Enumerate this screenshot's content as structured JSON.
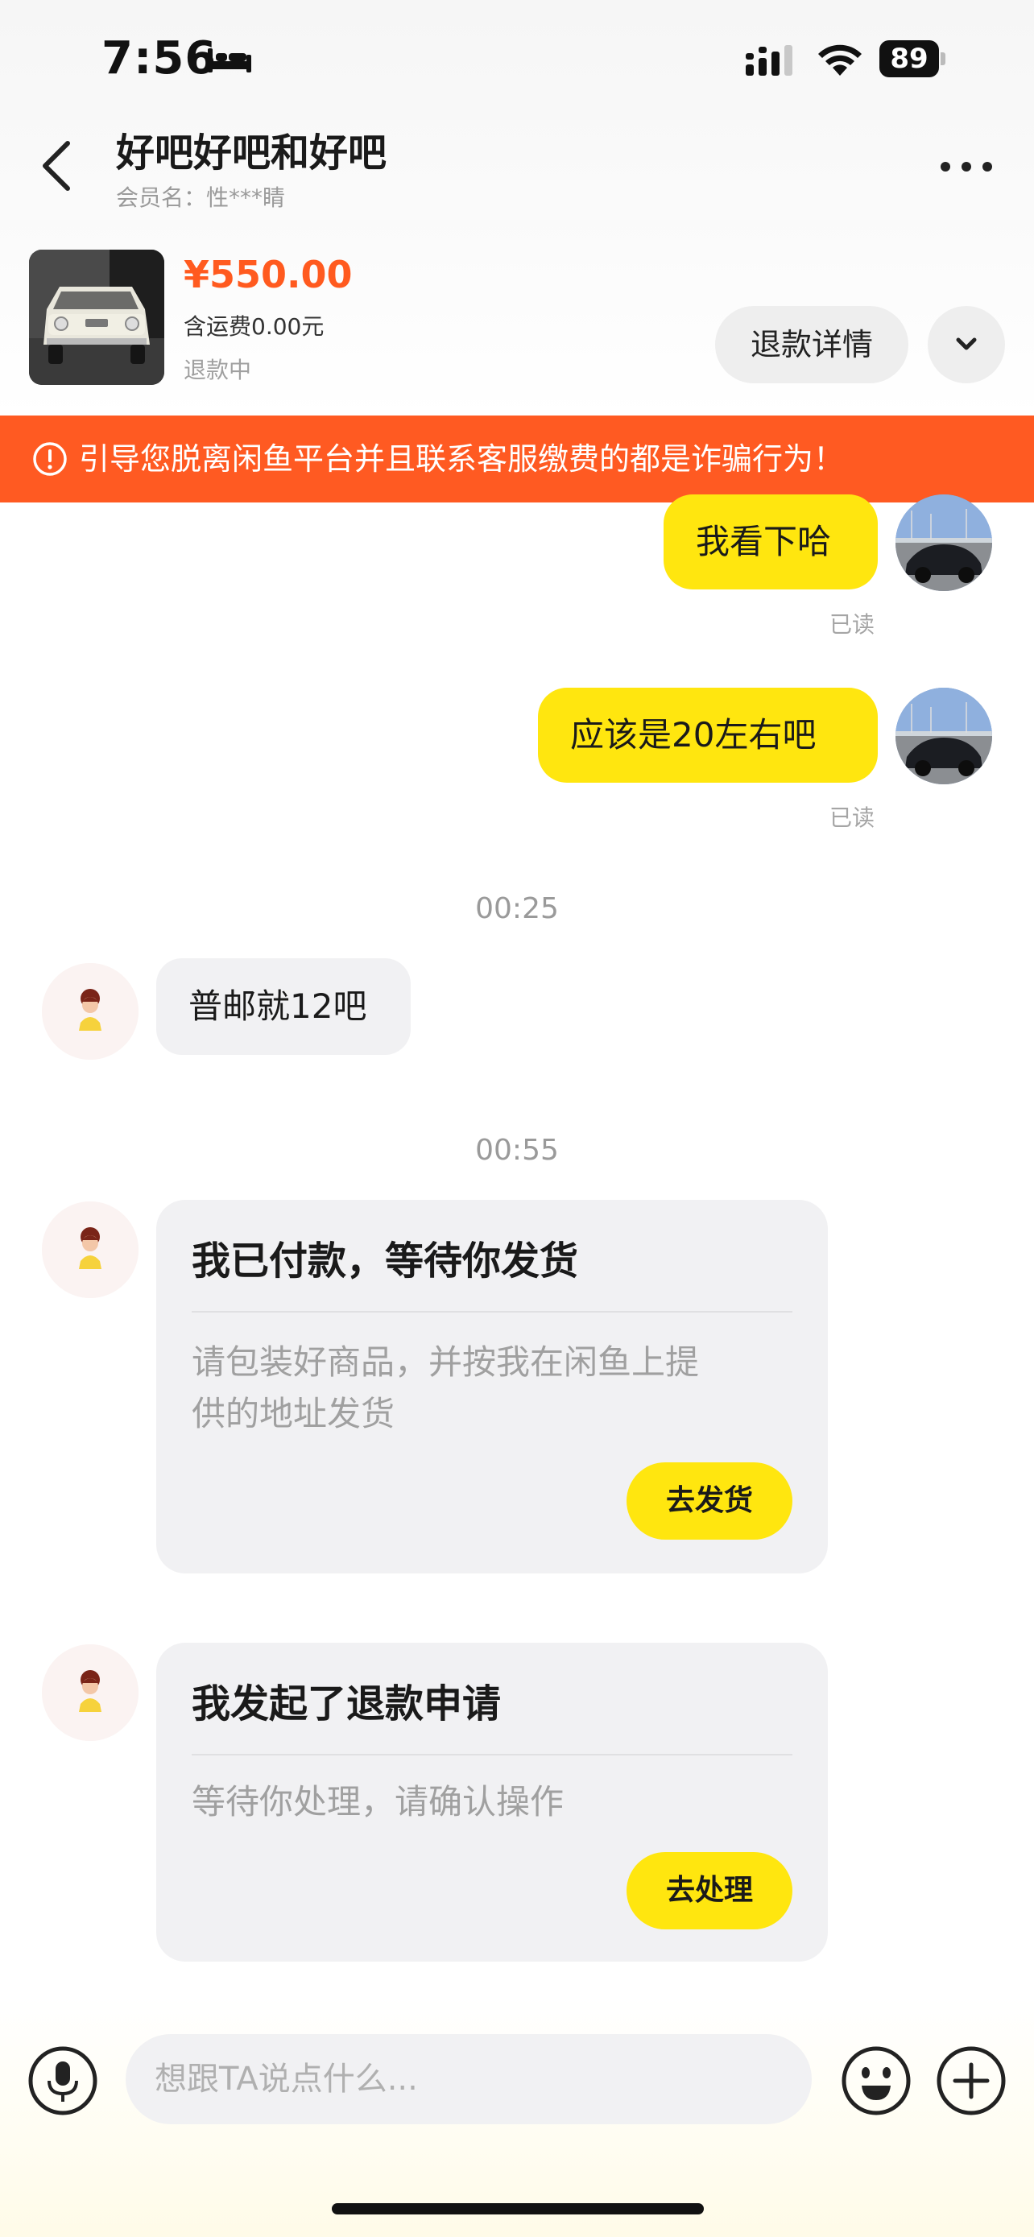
{
  "status_bar": {
    "time": "7:56",
    "battery": "89",
    "icons": [
      "bed-icon",
      "cellular-signal-icon",
      "wifi-icon",
      "battery-icon"
    ]
  },
  "header": {
    "title": "好吧好吧和好吧",
    "subtitle": "会员名：性***睛",
    "icons": [
      "back-arrow-icon",
      "more-icon"
    ]
  },
  "product": {
    "price": "¥550.00",
    "shipping": "含运费0.00元",
    "status": "退款中",
    "refund_button": "退款详情",
    "thumbnail_icon": "white-vintage-car-photo"
  },
  "warning": {
    "text": "引导您脱离闲鱼平台并且联系客服缴费的都是诈骗行为！",
    "icon": "exclamation-circle-icon"
  },
  "messages": [
    {
      "from": "me",
      "text": "我看下哈",
      "read": "已读"
    },
    {
      "from": "me",
      "text": "应该是20左右吧",
      "read": "已读"
    },
    {
      "type": "timestamp",
      "text": "00:25"
    },
    {
      "from": "them",
      "text": "普邮就12吧"
    },
    {
      "type": "timestamp",
      "text": "00:55"
    },
    {
      "from": "them",
      "type": "card",
      "title": "我已付款，等待你发货",
      "body": "请包装好商品，并按我在闲鱼上提供的地址发货",
      "body_lines": [
        "请包装好商品，并按我在闲鱼上提",
        "供的地址发货"
      ],
      "button": "去发货"
    },
    {
      "from": "them",
      "type": "card",
      "title": "我发起了退款申请",
      "body": "等待你处理，请确认操作",
      "button": "去处理"
    }
  ],
  "input_bar": {
    "placeholder": "想跟TA说点什么...",
    "icons": [
      "microphone-icon",
      "emoji-icon",
      "plus-icon"
    ]
  },
  "colors": {
    "accent_yellow": "#ffe60f",
    "price_orange": "#ff5a1f",
    "warning_orange": "#ff5a22",
    "bubble_gray": "#f1f1f3"
  }
}
